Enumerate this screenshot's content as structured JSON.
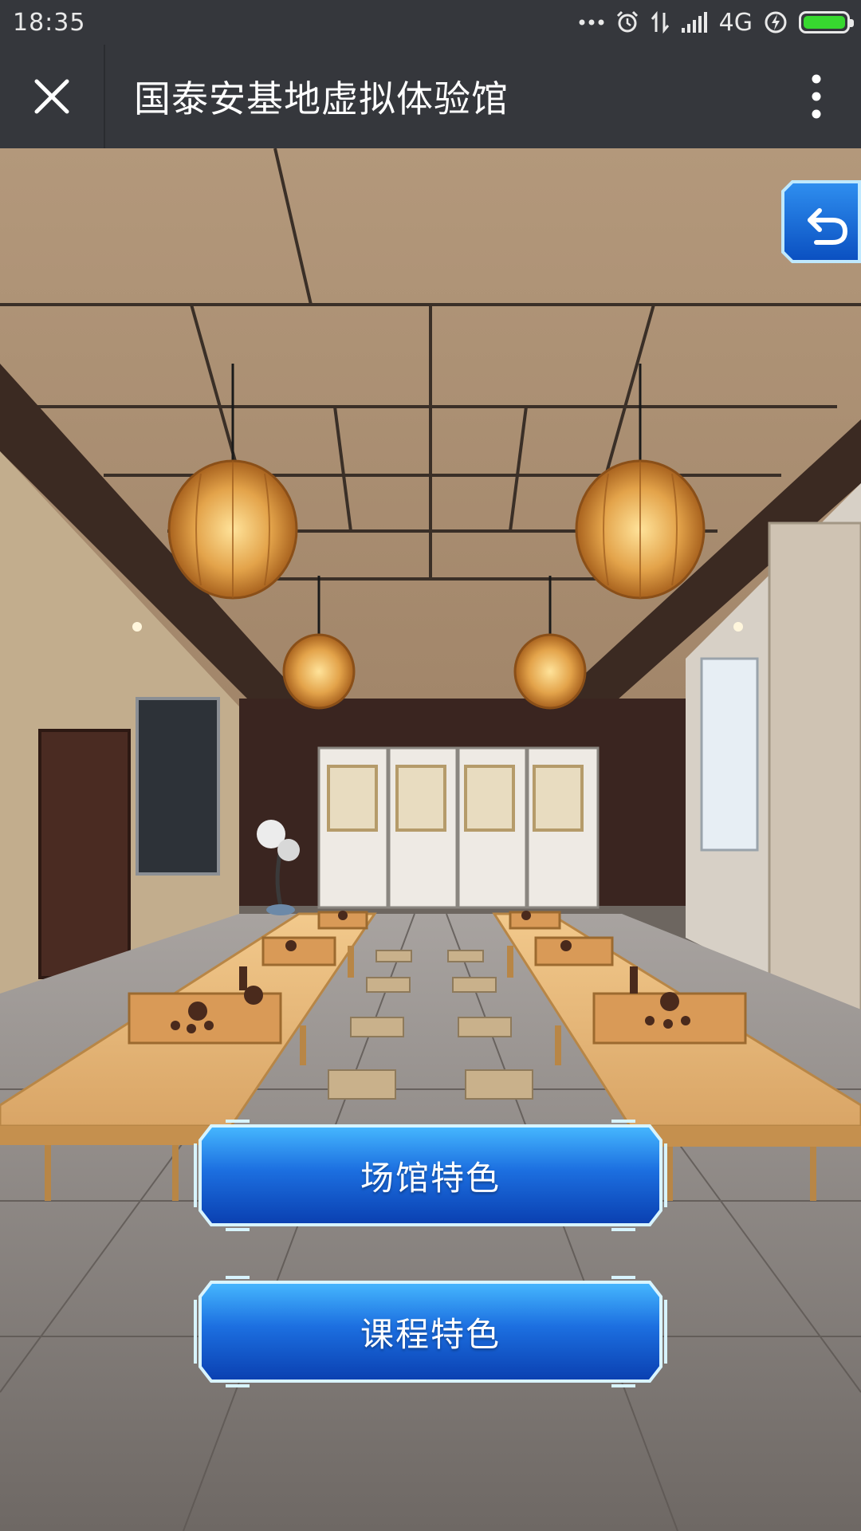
{
  "status_bar": {
    "time": "18:35",
    "network": "4G",
    "battery_level": 1.0,
    "battery_color": "#37d82f"
  },
  "title_bar": {
    "title": "国泰安基地虚拟体验馆",
    "close_icon": "close-icon",
    "more_icon": "more-vertical-icon"
  },
  "scene": {
    "back_icon": "undo-back-icon",
    "buttons": [
      {
        "label": "场馆特色"
      },
      {
        "label": "课程特色"
      }
    ]
  }
}
